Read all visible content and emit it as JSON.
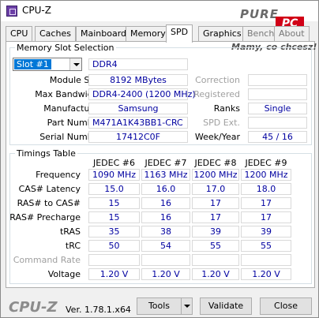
{
  "window": {
    "title": "CPU-Z"
  },
  "logo": {
    "text_pure": "PURE",
    "text_pc": "PC"
  },
  "watermark": "Mamy, co chcesz!",
  "tabs": [
    "CPU",
    "Caches",
    "Mainboard",
    "Memory",
    "SPD",
    "Graphics",
    "Bench",
    "About"
  ],
  "active_tab": "SPD",
  "slot_section": {
    "legend": "Memory Slot Selection",
    "slot_value": "Slot #1",
    "type": "DDR4",
    "rows": {
      "module_size": {
        "label": "Module Size",
        "value": "8192 MBytes"
      },
      "max_bandwidth": {
        "label": "Max Bandwidth",
        "value": "DDR4-2400 (1200 MHz)"
      },
      "manufacturer": {
        "label": "Manufacturer",
        "value": "Samsung"
      },
      "part_number": {
        "label": "Part Number",
        "value": "M471A1K43BB1-CRC"
      },
      "serial_number": {
        "label": "Serial Number",
        "value": "17412C0F"
      }
    },
    "right": {
      "correction": {
        "label": "Correction",
        "value": ""
      },
      "registered": {
        "label": "Registered",
        "value": ""
      },
      "ranks": {
        "label": "Ranks",
        "value": "Single"
      },
      "spd_ext": {
        "label": "SPD Ext.",
        "value": ""
      },
      "week_year": {
        "label": "Week/Year",
        "value": "45 / 16"
      }
    }
  },
  "timings": {
    "legend": "Timings Table",
    "columns": [
      "JEDEC #6",
      "JEDEC #7",
      "JEDEC #8",
      "JEDEC #9"
    ],
    "rows": [
      {
        "label": "Frequency",
        "values": [
          "1090 MHz",
          "1163 MHz",
          "1200 MHz",
          "1200 MHz"
        ]
      },
      {
        "label": "CAS# Latency",
        "values": [
          "15.0",
          "16.0",
          "17.0",
          "18.0"
        ]
      },
      {
        "label": "RAS# to CAS#",
        "values": [
          "15",
          "16",
          "17",
          "17"
        ]
      },
      {
        "label": "RAS# Precharge",
        "values": [
          "15",
          "16",
          "17",
          "17"
        ]
      },
      {
        "label": "tRAS",
        "values": [
          "35",
          "38",
          "39",
          "39"
        ]
      },
      {
        "label": "tRC",
        "values": [
          "50",
          "54",
          "55",
          "55"
        ]
      },
      {
        "label": "Command Rate",
        "values": [
          "",
          "",
          "",
          ""
        ]
      },
      {
        "label": "Voltage",
        "values": [
          "1.20 V",
          "1.20 V",
          "1.20 V",
          "1.20 V"
        ]
      }
    ]
  },
  "footer": {
    "logo": "CPU-Z",
    "version": "Ver. 1.78.1.x64",
    "tools": "Tools",
    "validate": "Validate",
    "close": "Close"
  }
}
